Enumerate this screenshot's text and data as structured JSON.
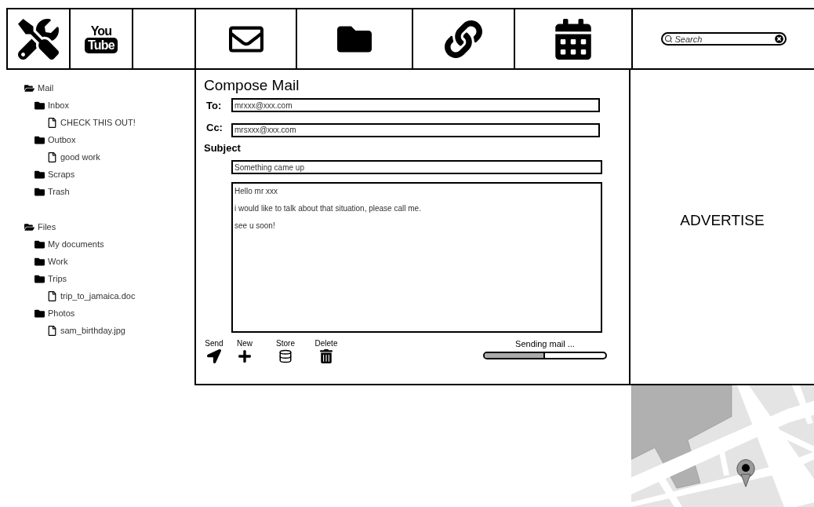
{
  "toolbar": {
    "logo": {
      "top": "You",
      "bottom": "Tube"
    },
    "search": {
      "placeholder": "Search"
    }
  },
  "tree": [
    {
      "label": "Mail",
      "kind": "group",
      "children": [
        {
          "label": "Inbox",
          "kind": "folder",
          "children": [
            {
              "label": "CHECK THIS OUT!",
              "kind": "file"
            }
          ]
        },
        {
          "label": "Outbox",
          "kind": "folder",
          "children": [
            {
              "label": "good work",
              "kind": "file"
            }
          ]
        },
        {
          "label": "Scraps",
          "kind": "folder"
        },
        {
          "label": "Trash",
          "kind": "folder"
        }
      ]
    },
    {
      "label": "Files",
      "kind": "group",
      "children": [
        {
          "label": "My documents",
          "kind": "folder"
        },
        {
          "label": "Work",
          "kind": "folder"
        },
        {
          "label": "Trips",
          "kind": "folder",
          "children": [
            {
              "label": "trip_to_jamaica.doc",
              "kind": "file"
            }
          ]
        },
        {
          "label": "Photos",
          "kind": "folder",
          "children": [
            {
              "label": "sam_birthday.jpg",
              "kind": "file"
            }
          ]
        }
      ]
    }
  ],
  "compose": {
    "title": "Compose Mail",
    "to_label": "To:",
    "to": "mrxxx@xxx.com",
    "cc_label": "Cc:",
    "cc": "mrsxxx@xxx.com",
    "subject_label": "Subject",
    "subject": "Something came up",
    "body": [
      "Hello mr xxx",
      "i would like to talk about that situation, please call me.",
      "see u soon!"
    ],
    "actions": [
      {
        "label": "Send",
        "kind": "send"
      },
      {
        "label": "New",
        "kind": "new"
      },
      {
        "label": "Store",
        "kind": "store"
      },
      {
        "label": "Delete",
        "kind": "delete"
      }
    ],
    "progress": {
      "label": "Sending mail ...",
      "level": 0.5
    }
  },
  "advert": {
    "label": "ADVERTISE"
  }
}
